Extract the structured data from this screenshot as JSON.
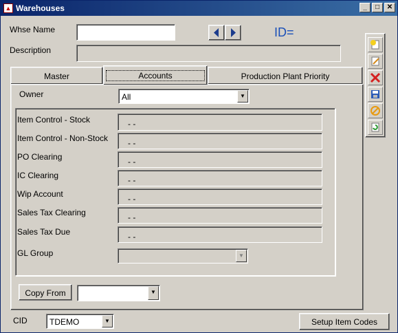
{
  "window": {
    "title": "Warehouses"
  },
  "header": {
    "whse_name_label": "Whse Name",
    "whse_name_value": "",
    "description_label": "Description",
    "description_value": "",
    "id_label": "ID="
  },
  "tabs": [
    {
      "label": "Master"
    },
    {
      "label": "Accounts"
    },
    {
      "label": "Production Plant Priority"
    }
  ],
  "accounts": {
    "owner_label": "Owner",
    "owner_value": "All",
    "rows": [
      {
        "label": "Item Control - Stock",
        "value": "- -"
      },
      {
        "label": "Item Control - Non-Stock",
        "value": "- -"
      },
      {
        "label": "PO Clearing",
        "value": "- -"
      },
      {
        "label": "IC Clearing",
        "value": "- -"
      },
      {
        "label": "Wip Account",
        "value": "- -"
      },
      {
        "label": "Sales Tax Clearing",
        "value": "- -"
      },
      {
        "label": "Sales Tax Due",
        "value": "- -"
      }
    ],
    "gl_group_label": "GL Group",
    "gl_group_value": "",
    "copy_from_label": "Copy From",
    "copy_from_value": ""
  },
  "footer": {
    "cid_label": "CID",
    "cid_value": "TDEMO",
    "setup_button_label": "Setup Item Codes"
  },
  "toolbar": {
    "icons": [
      "new-record-icon",
      "edit-icon",
      "delete-icon",
      "save-icon",
      "cancel-icon",
      "refresh-icon"
    ]
  }
}
